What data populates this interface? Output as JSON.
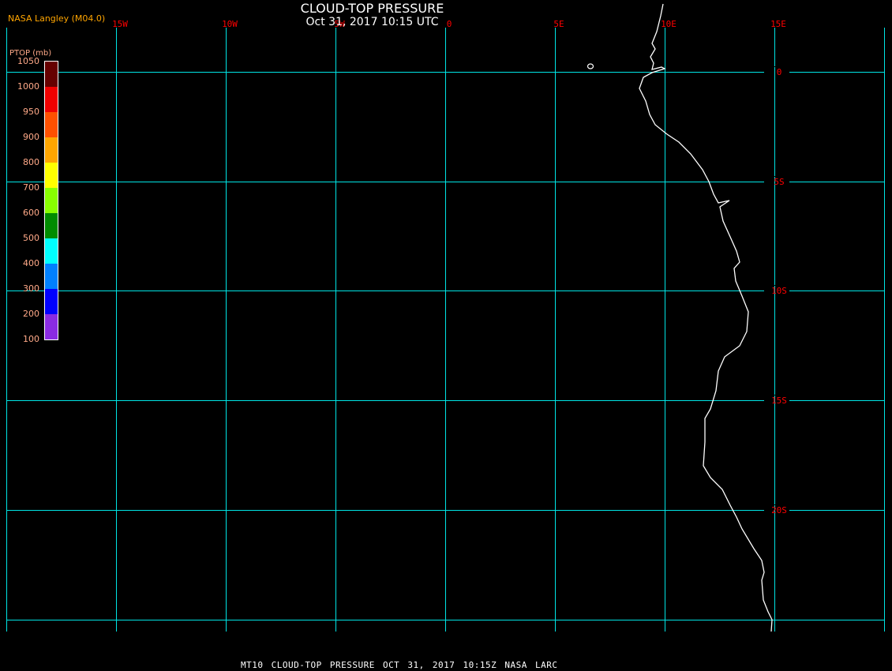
{
  "header": {
    "title": "CLOUD-TOP PRESSURE",
    "subtitle": "Oct 31, 2017 10:15 UTC",
    "credit": "NASA Langley (M04.0)"
  },
  "colorbar": {
    "title": "PTOP (mb)",
    "labels": [
      "1050",
      "1000",
      "950",
      "900",
      "800",
      "700",
      "600",
      "500",
      "400",
      "300",
      "200",
      "100"
    ],
    "colors": [
      "#660000",
      "#f00000",
      "#ff5000",
      "#ffa500",
      "#ffff00",
      "#88ff00",
      "#008c00",
      "#00ffff",
      "#0080ff",
      "#0000ff",
      "#8a2be2"
    ]
  },
  "map": {
    "grid_color": "#00e5e5",
    "label_color": "#ff0000",
    "coast_color": "#ffffff",
    "longitudes": [
      "",
      "15W",
      "10W",
      "5W",
      "0",
      "5E",
      "10E",
      "15E",
      ""
    ],
    "latitudes": [
      "0",
      "5S",
      "10S",
      "15S",
      "20S",
      ""
    ]
  },
  "footer": {
    "text": "MT10  CLOUD-TOP PRESSURE   OCT 31, 2017 10:15Z   NASA LARC"
  }
}
